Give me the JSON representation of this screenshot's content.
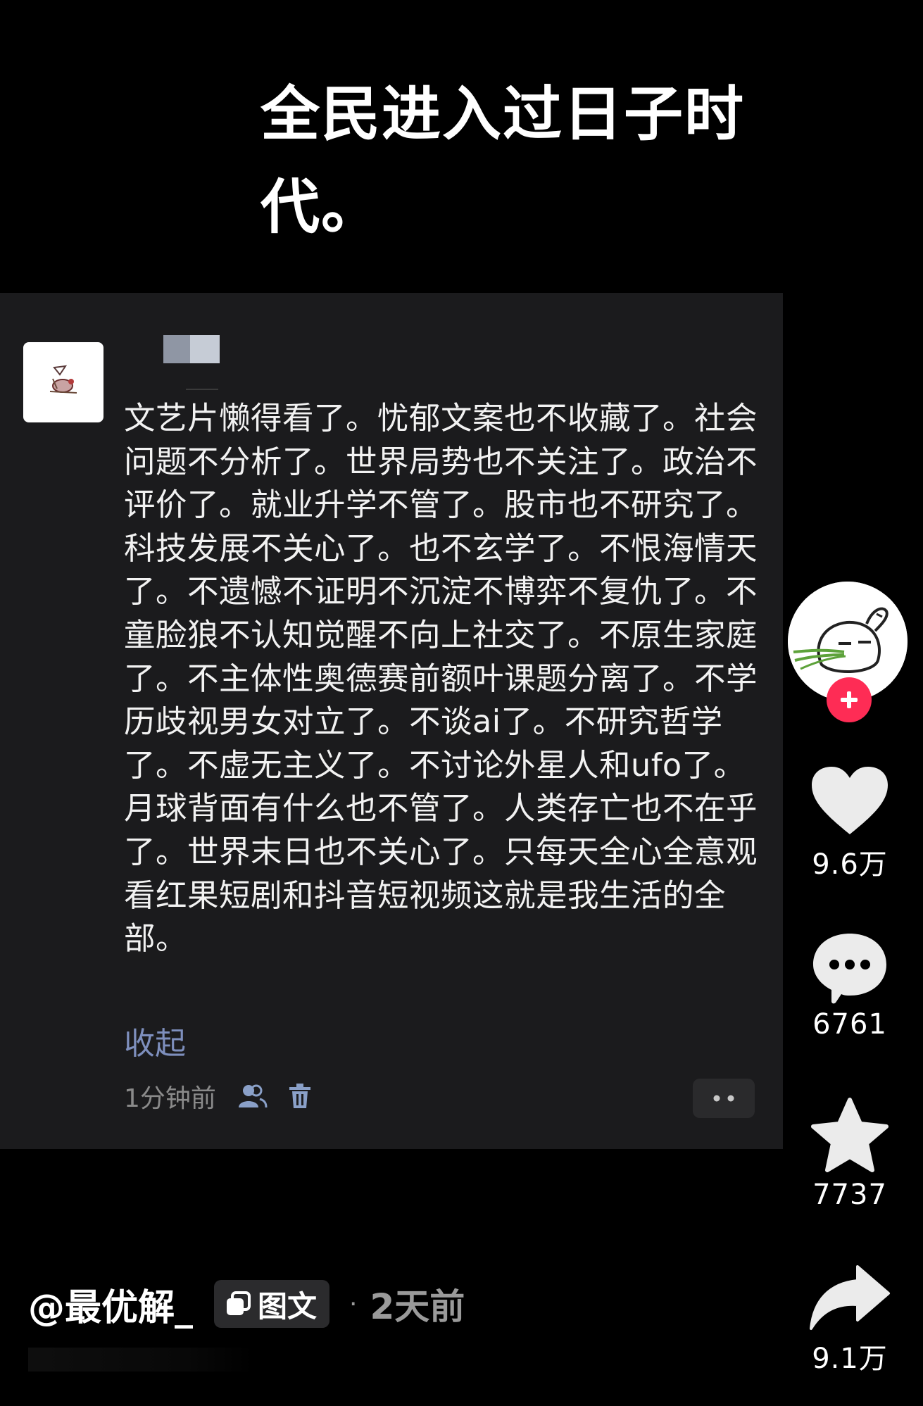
{
  "headline": {
    "line1": "全民进入过日子时",
    "line2": "代。"
  },
  "comment": {
    "text": "文艺片懒得看了。忧郁文案也不收藏了。社会问题不分析了。世界局势也不关注了。政治不评价了。就业升学不管了。股市也不研究了。科技发展不关心了。也不玄学了。不恨海情天了。不遗憾不证明不沉淀不博弈不复仇了。不童脸狼不认知觉醒不向上社交了。不原生家庭了。不主体性奥德赛前额叶课题分离了。不学历歧视男女对立了。不谈ai了。不研究哲学了。不虚无主义了。不讨论外星人和ufo了。月球背面有什么也不管了。人类存亡也不在乎了。世界末日也不关心了。只每天全心全意观看红果短剧和抖音短视频这就是我生活的全部。",
    "collapse_label": "收起",
    "time": "1分钟前"
  },
  "rail": {
    "like_count": "9.6万",
    "comment_count": "6761",
    "favorite_count": "7737",
    "share_count": "9.1万"
  },
  "footer": {
    "author": "@最优解_",
    "tag_label": "图文",
    "separator": "·",
    "post_time": "2天前"
  },
  "colors": {
    "accent_red": "#fe2c55",
    "link_blue": "#7e8fbd",
    "card_bg": "#1b1b1d"
  },
  "icons": {
    "rail_avatar": "cartoon-bunny-icon",
    "follow": "plus-icon",
    "like": "heart-icon",
    "comment": "chat-bubble-icon",
    "favorite": "star-icon",
    "share": "share-arrow-icon",
    "visibility": "people-icon",
    "delete": "trash-icon",
    "more": "more-dots-icon",
    "tag": "image-text-icon"
  }
}
